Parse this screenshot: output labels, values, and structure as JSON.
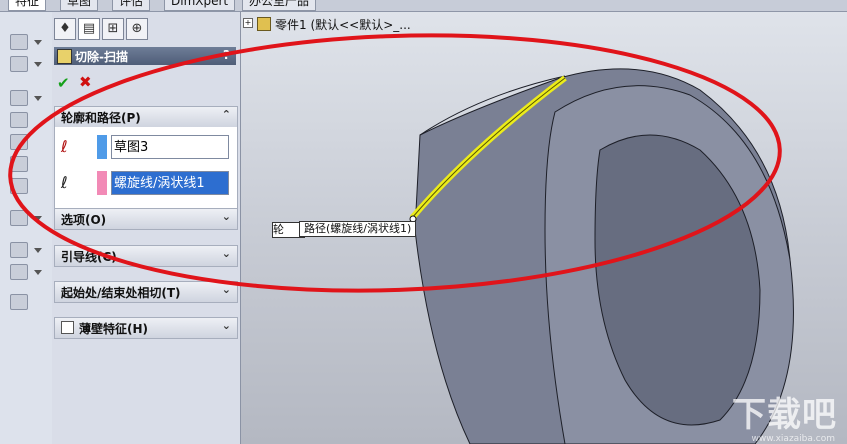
{
  "tabs": [
    {
      "label": "特征",
      "active": true
    },
    {
      "label": "草图",
      "active": false
    },
    {
      "label": "评估",
      "active": false
    },
    {
      "label": "DimXpert",
      "active": false
    },
    {
      "label": "办公室产品",
      "active": false
    }
  ],
  "panel": {
    "title": "切除-扫描",
    "help": "?",
    "sections": {
      "profile_path": {
        "label": "轮廓和路径(P)",
        "expanded": true,
        "profile_value": "草图3",
        "path_value": "螺旋线/涡状线1"
      },
      "options": {
        "label": "选项(O)"
      },
      "guides": {
        "label": "引导线(C)"
      },
      "tangency": {
        "label": "起始处/结束处相切(T)"
      },
      "thin": {
        "label": "薄壁特征(H)",
        "checked": false
      }
    }
  },
  "viewport": {
    "tree_label": "零件1 (默认<<默认>_...",
    "callout_profile": "轮",
    "callout_path": "路径(螺旋线/涡状线1)"
  },
  "watermark": {
    "text": "下载吧",
    "url": "www.xiazaiba.com"
  },
  "colors": {
    "annotation_ellipse": "#e0141a",
    "helix": "#e8e800",
    "part": "#7c8296",
    "profile_swatch": "#4f9be8",
    "path_swatch": "#f28ab6"
  }
}
